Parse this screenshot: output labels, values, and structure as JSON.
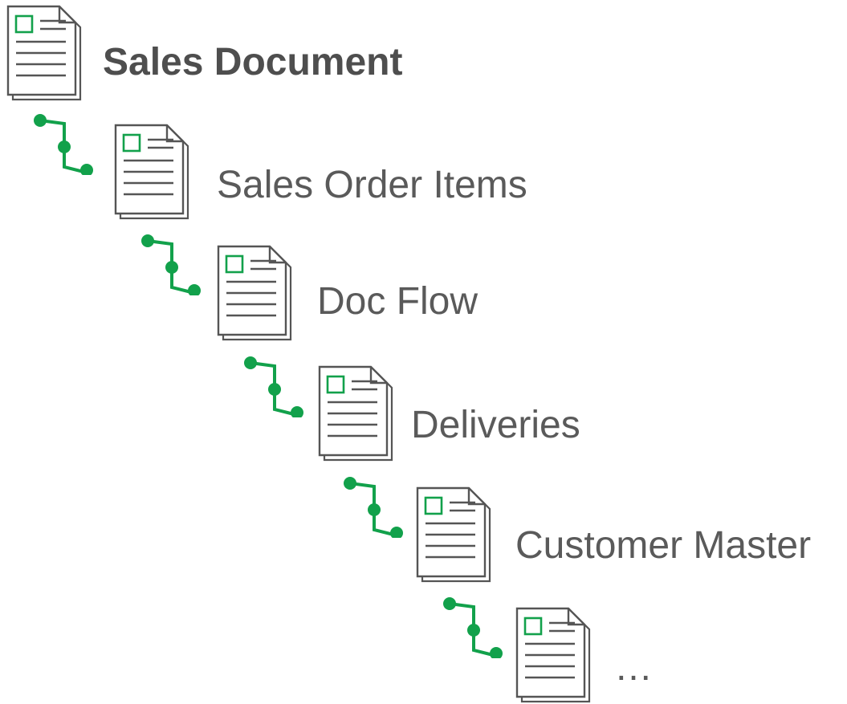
{
  "tree": {
    "nodes": [
      {
        "label": "Sales Document",
        "emphasis": "bold"
      },
      {
        "label": "Sales Order Items",
        "emphasis": "normal"
      },
      {
        "label": "Doc Flow",
        "emphasis": "normal"
      },
      {
        "label": "Deliveries",
        "emphasis": "normal"
      },
      {
        "label": "Customer Master",
        "emphasis": "normal"
      },
      {
        "label": "…",
        "emphasis": "normal"
      }
    ]
  },
  "colors": {
    "connector": "#12a14b",
    "icon_accent": "#12a14b",
    "icon_outline": "#555555",
    "text": "#5a5a5a"
  },
  "icons": {
    "node_icon": "document-icon",
    "link_icon": "hierarchy-connector-icon"
  }
}
